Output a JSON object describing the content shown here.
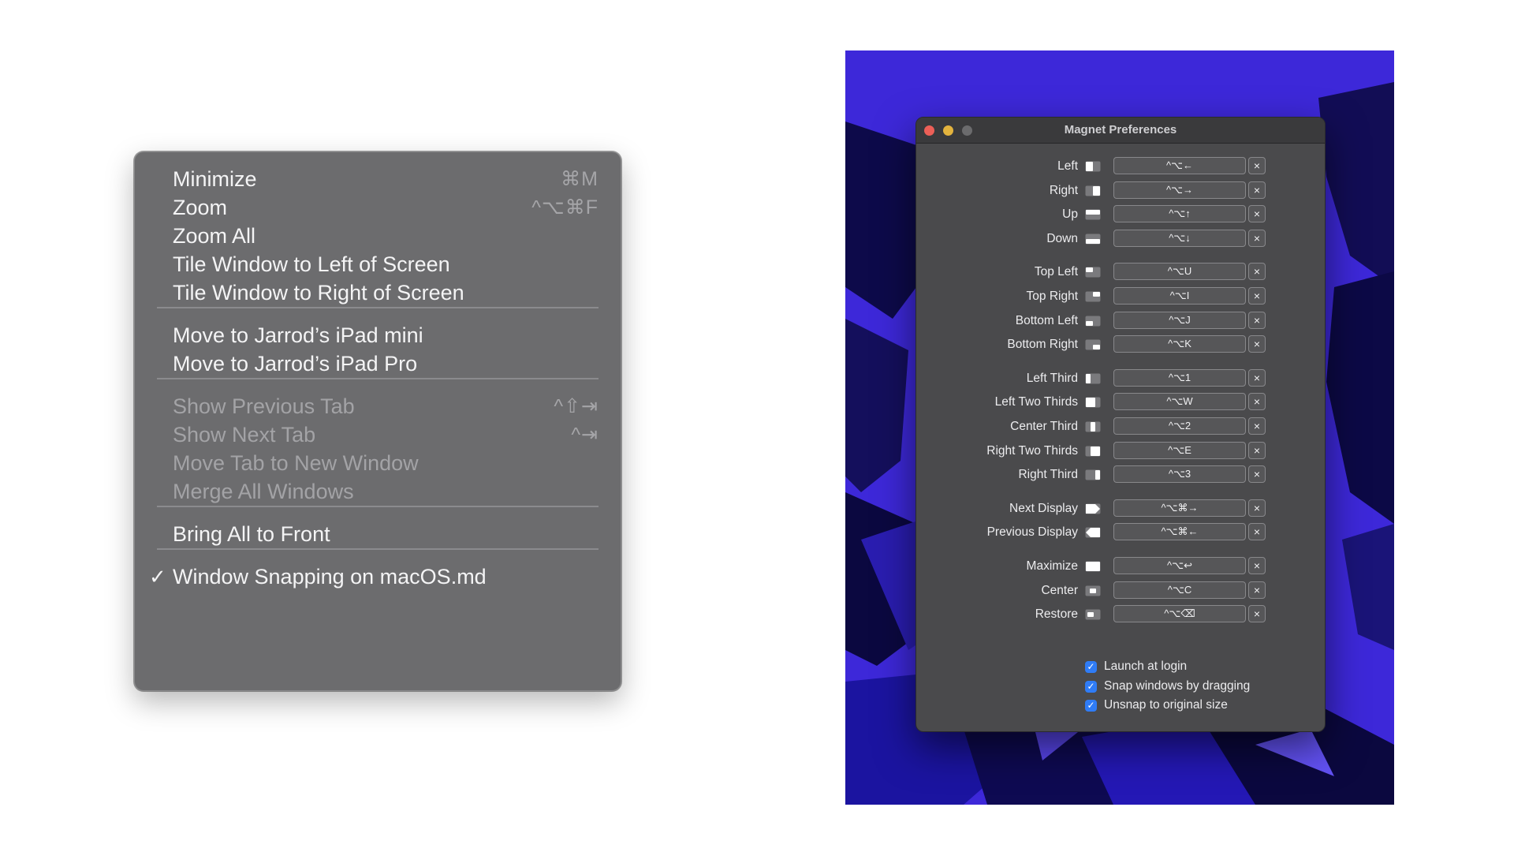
{
  "menu": {
    "items": [
      {
        "label": "Minimize",
        "shortcut": "⌘M",
        "enabled": true
      },
      {
        "label": "Zoom",
        "shortcut": "^⌥⌘F",
        "enabled": true
      },
      {
        "label": "Zoom All",
        "shortcut": "",
        "enabled": true
      },
      {
        "label": "Tile Window to Left of Screen",
        "shortcut": "",
        "enabled": true
      },
      {
        "label": "Tile Window to Right of Screen",
        "shortcut": "",
        "enabled": true
      },
      {
        "label": "Move to Jarrod’s iPad mini",
        "shortcut": "",
        "enabled": true
      },
      {
        "label": "Move to Jarrod’s iPad Pro",
        "shortcut": "",
        "enabled": true
      },
      {
        "label": "Show Previous Tab",
        "shortcut": "^⇧⇥",
        "enabled": false
      },
      {
        "label": "Show Next Tab",
        "shortcut": "^⇥",
        "enabled": false
      },
      {
        "label": "Move Tab to New Window",
        "shortcut": "",
        "enabled": false
      },
      {
        "label": "Merge All Windows",
        "shortcut": "",
        "enabled": false
      },
      {
        "label": "Bring All to Front",
        "shortcut": "",
        "enabled": true
      },
      {
        "label": "Window Snapping on macOS.md",
        "shortcut": "",
        "enabled": true,
        "checked": true
      }
    ],
    "check_mark": "✓"
  },
  "magnet": {
    "title": "Magnet Preferences",
    "clear_symbol": "×",
    "groups": [
      [
        {
          "label": "Left",
          "shortcut": "^⌥←",
          "icon": "left-half-icon"
        },
        {
          "label": "Right",
          "shortcut": "^⌥→",
          "icon": "right-half-icon"
        },
        {
          "label": "Up",
          "shortcut": "^⌥↑",
          "icon": "top-half-icon"
        },
        {
          "label": "Down",
          "shortcut": "^⌥↓",
          "icon": "bottom-half-icon"
        }
      ],
      [
        {
          "label": "Top Left",
          "shortcut": "^⌥U",
          "icon": "top-left-icon"
        },
        {
          "label": "Top Right",
          "shortcut": "^⌥I",
          "icon": "top-right-icon"
        },
        {
          "label": "Bottom Left",
          "shortcut": "^⌥J",
          "icon": "bottom-left-icon"
        },
        {
          "label": "Bottom Right",
          "shortcut": "^⌥K",
          "icon": "bottom-right-icon"
        }
      ],
      [
        {
          "label": "Left Third",
          "shortcut": "^⌥1",
          "icon": "left-third-icon"
        },
        {
          "label": "Left Two Thirds",
          "shortcut": "^⌥W",
          "icon": "left-two-thirds-icon"
        },
        {
          "label": "Center Third",
          "shortcut": "^⌥2",
          "icon": "center-third-icon"
        },
        {
          "label": "Right Two Thirds",
          "shortcut": "^⌥E",
          "icon": "right-two-thirds-icon"
        },
        {
          "label": "Right Third",
          "shortcut": "^⌥3",
          "icon": "right-third-icon"
        }
      ],
      [
        {
          "label": "Next Display",
          "shortcut": "^⌥⌘→",
          "icon": "next-display-icon"
        },
        {
          "label": "Previous Display",
          "shortcut": "^⌥⌘←",
          "icon": "previous-display-icon"
        }
      ],
      [
        {
          "label": "Maximize",
          "shortcut": "^⌥↩",
          "icon": "maximize-icon"
        },
        {
          "label": "Center",
          "shortcut": "^⌥C",
          "icon": "center-icon"
        },
        {
          "label": "Restore",
          "shortcut": "^⌥⌫",
          "icon": "restore-icon"
        }
      ]
    ],
    "options": [
      {
        "label": "Launch at login",
        "checked": true
      },
      {
        "label": "Snap windows by dragging",
        "checked": true
      },
      {
        "label": "Unsnap to original size",
        "checked": true
      }
    ],
    "check_symbol": "✓"
  },
  "colors": {
    "wallpaper": "#3d28d9",
    "menu_bg": "#6c6c6e",
    "checkbox_accent": "#2f7cf6"
  }
}
